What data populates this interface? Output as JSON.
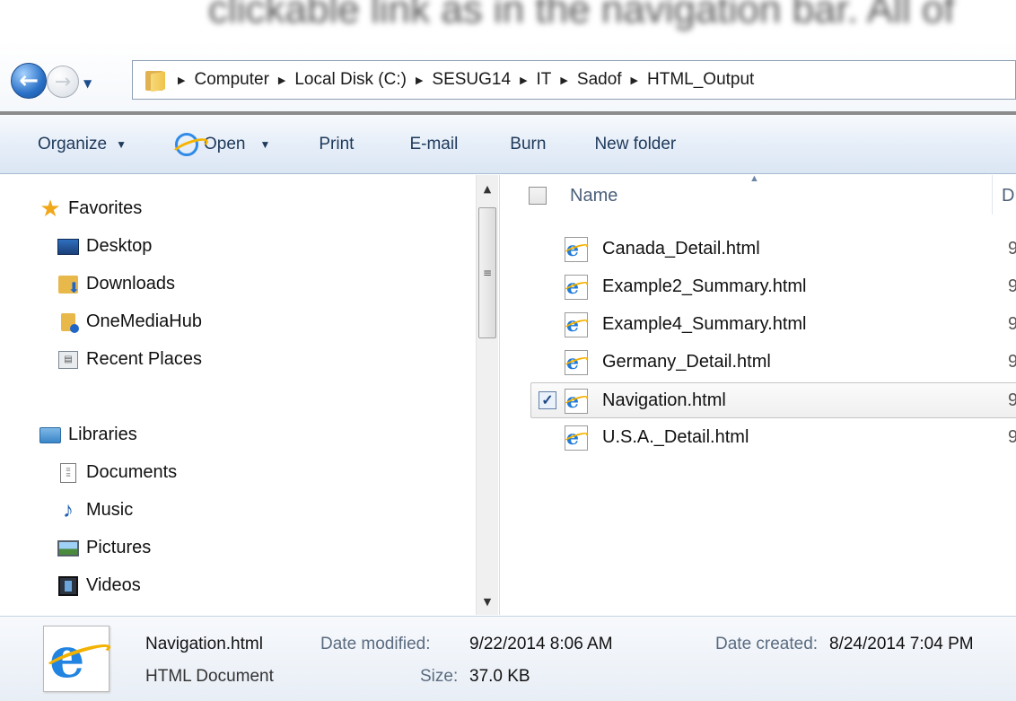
{
  "blurred_text": "clickable link as in the navigation bar. All of",
  "address_bar": {
    "crumbs": [
      "Computer",
      "Local Disk (C:)",
      "SESUG14",
      "IT",
      "Sadof",
      "HTML_Output"
    ]
  },
  "toolbar": {
    "organize": "Organize",
    "open": "Open",
    "print": "Print",
    "email": "E-mail",
    "burn": "Burn",
    "new_folder": "New folder"
  },
  "navpane": {
    "favorites": "Favorites",
    "desktop": "Desktop",
    "downloads": "Downloads",
    "onemediahub": "OneMediaHub",
    "recent_places": "Recent Places",
    "libraries": "Libraries",
    "documents": "Documents",
    "music": "Music",
    "pictures": "Pictures",
    "videos": "Videos"
  },
  "filelist": {
    "col_name": "Name",
    "col_next": "D",
    "files": [
      {
        "name": "Canada_Detail.html",
        "cut": "9"
      },
      {
        "name": "Example2_Summary.html",
        "cut": "9"
      },
      {
        "name": "Example4_Summary.html",
        "cut": "9"
      },
      {
        "name": "Germany_Detail.html",
        "cut": "9"
      },
      {
        "name": "Navigation.html",
        "cut": "9",
        "selected": true
      },
      {
        "name": "U.S.A._Detail.html",
        "cut": "9"
      }
    ]
  },
  "details": {
    "file_name": "Navigation.html",
    "file_type": "HTML Document",
    "date_modified_label": "Date modified:",
    "date_modified": "9/22/2014 8:06 AM",
    "size_label": "Size:",
    "size": "37.0 KB",
    "date_created_label": "Date created:",
    "date_created": "8/24/2014 7:04 PM"
  }
}
